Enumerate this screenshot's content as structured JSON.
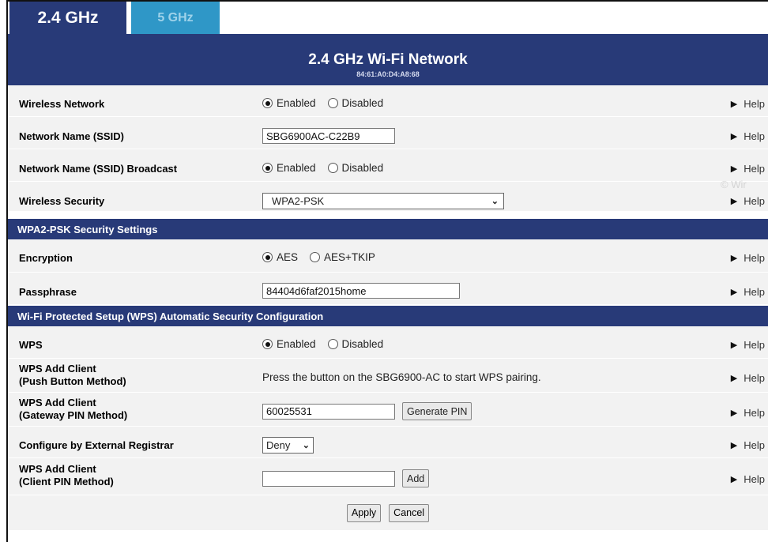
{
  "tabs": {
    "active": "2.4 GHz",
    "other": "5 GHz"
  },
  "banner": {
    "title": "2.4 GHz Wi-Fi Network",
    "mac": "84:61:A0:D4:A8:68"
  },
  "help_label": "Help",
  "rows": {
    "wireless_network": {
      "label": "Wireless Network",
      "opt1": "Enabled",
      "opt2": "Disabled",
      "selected": "Enabled"
    },
    "ssid": {
      "label": "Network Name (SSID)",
      "value": "SBG6900AC-C22B9"
    },
    "ssid_broadcast": {
      "label": "Network Name (SSID) Broadcast",
      "opt1": "Enabled",
      "opt2": "Disabled",
      "selected": "Enabled"
    },
    "wireless_security": {
      "label": "Wireless Security",
      "value": "WPA2-PSK"
    },
    "encryption": {
      "label": "Encryption",
      "opt1": "AES",
      "opt2": "AES+TKIP",
      "selected": "AES"
    },
    "passphrase": {
      "label": "Passphrase",
      "value": "84404d6faf2015home"
    },
    "wps": {
      "label": "WPS",
      "opt1": "Enabled",
      "opt2": "Disabled",
      "selected": "Enabled"
    },
    "wps_push": {
      "label1": "WPS Add Client",
      "label2": "(Push Button Method)",
      "text": "Press the button on the SBG6900-AC to start WPS pairing."
    },
    "wps_gateway_pin": {
      "label1": "WPS Add Client",
      "label2": "(Gateway PIN Method)",
      "value": "60025531",
      "button": "Generate PIN"
    },
    "external_registrar": {
      "label": "Configure by External Registrar",
      "value": "Deny"
    },
    "wps_client_pin": {
      "label1": "WPS Add Client",
      "label2": "(Client PIN Method)",
      "value": "",
      "button": "Add"
    }
  },
  "sections": {
    "wpa2": "WPA2-PSK Security Settings",
    "wps": "Wi-Fi Protected Setup (WPS) Automatic Security Configuration"
  },
  "actions": {
    "apply": "Apply",
    "cancel": "Cancel"
  },
  "watermark": "© Wir",
  "colors": {
    "header_blue": "#283a78",
    "tab_inactive": "#2f97c7",
    "row_bg": "#f2f2f2"
  }
}
